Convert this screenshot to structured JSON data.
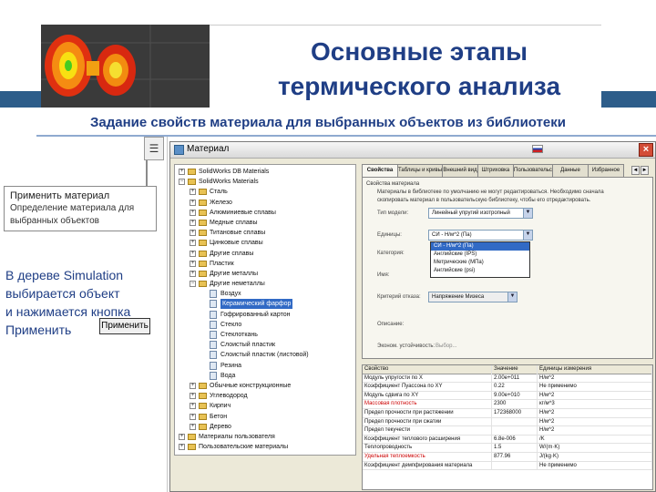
{
  "slide": {
    "title_line1": "Основные этапы",
    "title_line2": "термического анализа",
    "subtitle": "Задание свойств материала для выбранных объектов из библиотеки"
  },
  "left_panel": {
    "callout_title": "Применить материал",
    "callout_desc_1": "Определение материала для",
    "callout_desc_2": "выбранных объектов",
    "note_line1": "В дереве Simulation",
    "note_line2": "выбирается объект",
    "note_line3": "и нажимается кнопка",
    "note_line4": "Применить",
    "apply_button": "Применить"
  },
  "dialog": {
    "title": "Материал",
    "close_label": "×",
    "tree": [
      {
        "label": "SolidWorks DB Materials",
        "level": 0,
        "type": "folder",
        "exp": "+"
      },
      {
        "label": "SolidWorks Materials",
        "level": 0,
        "type": "folder",
        "exp": "−"
      },
      {
        "label": "Сталь",
        "level": 1,
        "type": "folder",
        "exp": "+"
      },
      {
        "label": "Железо",
        "level": 1,
        "type": "folder",
        "exp": "+"
      },
      {
        "label": "Алюминиевые сплавы",
        "level": 1,
        "type": "folder",
        "exp": "+"
      },
      {
        "label": "Медные сплавы",
        "level": 1,
        "type": "folder",
        "exp": "+"
      },
      {
        "label": "Титановые сплавы",
        "level": 1,
        "type": "folder",
        "exp": "+"
      },
      {
        "label": "Цинковые сплавы",
        "level": 1,
        "type": "folder",
        "exp": "+"
      },
      {
        "label": "Другие сплавы",
        "level": 1,
        "type": "folder",
        "exp": "+"
      },
      {
        "label": "Пластик",
        "level": 1,
        "type": "folder",
        "exp": "+"
      },
      {
        "label": "Другие металлы",
        "level": 1,
        "type": "folder",
        "exp": "+"
      },
      {
        "label": "Другие неметаллы",
        "level": 1,
        "type": "folder",
        "exp": "−"
      },
      {
        "label": "Воздух",
        "level": 2,
        "type": "file",
        "exp": ""
      },
      {
        "label": "Керамический фарфор",
        "level": 2,
        "type": "file",
        "exp": "",
        "selected": true
      },
      {
        "label": "Гофрированный картон",
        "level": 2,
        "type": "file",
        "exp": ""
      },
      {
        "label": "Стекло",
        "level": 2,
        "type": "file",
        "exp": ""
      },
      {
        "label": "Стеклоткань",
        "level": 2,
        "type": "file",
        "exp": ""
      },
      {
        "label": "Слоистый пластик",
        "level": 2,
        "type": "file",
        "exp": ""
      },
      {
        "label": "Слоистый пластик (листовой)",
        "level": 2,
        "type": "file",
        "exp": ""
      },
      {
        "label": "Резина",
        "level": 2,
        "type": "file",
        "exp": ""
      },
      {
        "label": "Вода",
        "level": 2,
        "type": "file",
        "exp": ""
      },
      {
        "label": "Обычные конструкционные",
        "level": 1,
        "type": "folder",
        "exp": "+"
      },
      {
        "label": "Углеводород",
        "level": 1,
        "type": "folder",
        "exp": "+"
      },
      {
        "label": "Кирпич",
        "level": 1,
        "type": "folder",
        "exp": "+"
      },
      {
        "label": "Бетон",
        "level": 1,
        "type": "folder",
        "exp": "+"
      },
      {
        "label": "Дерево",
        "level": 1,
        "type": "folder",
        "exp": "+"
      },
      {
        "label": "Материалы пользователя",
        "level": 0,
        "type": "folder",
        "exp": "+"
      },
      {
        "label": "Пользовательские материалы",
        "level": 0,
        "type": "folder",
        "exp": "+"
      }
    ],
    "tabs": [
      "Свойства",
      "Таблицы и кривые",
      "Внешний вид",
      "Штриховка",
      "Пользовательские",
      "Данные",
      "Избранное"
    ],
    "props": {
      "group_title": "Свойства материала",
      "note_1": "Материалы в библиотеке по умолчанию не могут редактироваться. Необходимо сначала",
      "note_2": "скопировать материал в пользовательскую библиотеку, чтобы его отредактировать.",
      "type_label": "Тип модели:",
      "type_value": "Линейный упругий изотропный",
      "units_label": "Единицы:",
      "units_value": "СИ - Н/м^2 (Па)",
      "category_label": "Категория:",
      "name_label": "Имя:",
      "criterion_label": "Критерий отказа:",
      "source_label": "Описание:",
      "sustainability_label": "Эконом. устойчивость:",
      "units_options": [
        "СИ - Н/м^2 (Па)",
        "Английские (IPS)",
        "Метрические (МПа)",
        "Английские (psi)"
      ],
      "criterion_value": "Напряжение Мизеса",
      "link_text": "Выбор..."
    },
    "grid": {
      "headers": [
        "Свойство",
        "Значение",
        "Единицы измерения"
      ],
      "rows": [
        [
          "Модуль упругости по X",
          "2.00e+011",
          "Н/м^2"
        ],
        [
          "Коэффициент Пуассона по XY",
          "0.22",
          "Не применимо"
        ],
        [
          "Модуль сдвига по XY",
          "9.00e+010",
          "Н/м^2"
        ],
        [
          "Массовая плотность",
          "2300",
          "кг/м^3"
        ],
        [
          "Предел прочности при растяжении",
          "172368000",
          "Н/м^2"
        ],
        [
          "Предел прочности при сжатии",
          "",
          "Н/м^2"
        ],
        [
          "Предел текучести",
          "",
          "Н/м^2"
        ],
        [
          "Коэффициент теплового расширения",
          "6.8e-006",
          "/K"
        ],
        [
          "Теплопроводность",
          "1.5",
          "W/(m·K)"
        ],
        [
          "Удельная теплоемкость",
          "877.96",
          "J/(kg·K)"
        ],
        [
          "Коэффициент демпфирования материала",
          "",
          "Не применимо"
        ]
      ],
      "red_rows": [
        3,
        9
      ]
    }
  }
}
